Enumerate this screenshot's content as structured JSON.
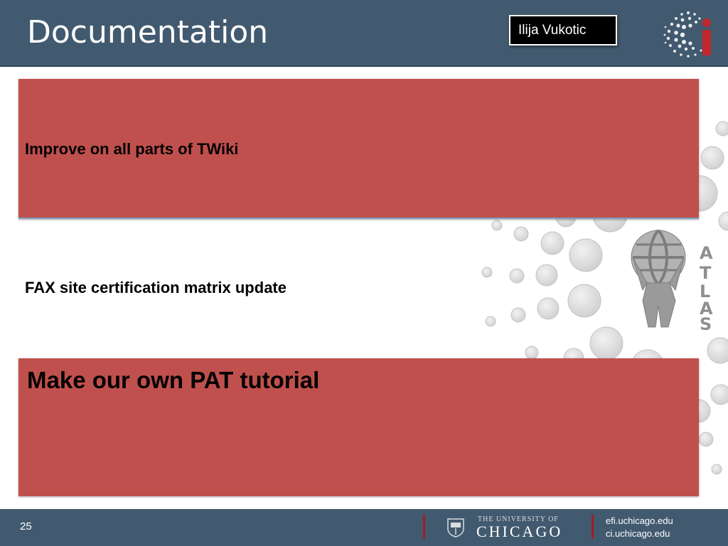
{
  "slide": {
    "title": "Documentation",
    "author": "Ilija Vukotic",
    "bullets": [
      "Improve on all parts of TWiki",
      "FAX site certification matrix update",
      "Make our own PAT tutorial"
    ]
  },
  "logos": {
    "ci": "ci-logo",
    "atlas": "ATLAS",
    "university_top": "THE UNIVERSITY OF",
    "university_name": "CHICAGO"
  },
  "footer": {
    "page_number": "25",
    "links": [
      "efi.uchicago.edu",
      "ci.uchicago.edu"
    ]
  },
  "colors": {
    "header": "#425a6f",
    "box": "#c0504d",
    "separator": "#a01d24"
  }
}
